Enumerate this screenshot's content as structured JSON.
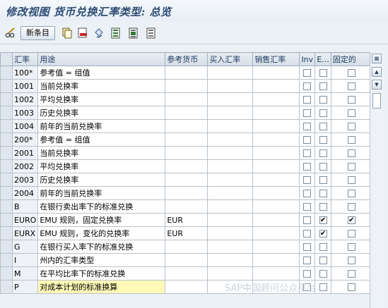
{
  "window": {
    "title": "修改视图 货币兑换汇率类型: 总览"
  },
  "toolbar": {
    "new_entries_label": "新条目",
    "icons": [
      "glasses-pen-icon",
      "copy-icon",
      "delete-icon",
      "undo-icon",
      "select-all-icon",
      "select-block-icon",
      "deselect-all-icon"
    ]
  },
  "table": {
    "columns": [
      "汇率",
      "用途",
      "参考货币",
      "买入汇率",
      "销售汇率",
      "Inv",
      "E...",
      "固定的"
    ],
    "rows": [
      {
        "key": "100*",
        "desc": "参考值 = 组值",
        "ref": "",
        "buy": "",
        "sell": "",
        "inv": false,
        "e": false,
        "fixed": false
      },
      {
        "key": "1001",
        "desc": "当前兑换率",
        "ref": "",
        "buy": "",
        "sell": "",
        "inv": false,
        "e": false,
        "fixed": false
      },
      {
        "key": "1002",
        "desc": "平均兑换率",
        "ref": "",
        "buy": "",
        "sell": "",
        "inv": false,
        "e": false,
        "fixed": false
      },
      {
        "key": "1003",
        "desc": "历史兑换率",
        "ref": "",
        "buy": "",
        "sell": "",
        "inv": false,
        "e": false,
        "fixed": false
      },
      {
        "key": "1004",
        "desc": "前年的当前兑换率",
        "ref": "",
        "buy": "",
        "sell": "",
        "inv": false,
        "e": false,
        "fixed": false
      },
      {
        "key": "200*",
        "desc": "参考值 = 组值",
        "ref": "",
        "buy": "",
        "sell": "",
        "inv": false,
        "e": false,
        "fixed": false
      },
      {
        "key": "2001",
        "desc": "当前兑换率",
        "ref": "",
        "buy": "",
        "sell": "",
        "inv": false,
        "e": false,
        "fixed": false
      },
      {
        "key": "2002",
        "desc": "平均兑换率",
        "ref": "",
        "buy": "",
        "sell": "",
        "inv": false,
        "e": false,
        "fixed": false
      },
      {
        "key": "2003",
        "desc": "历史兑换率",
        "ref": "",
        "buy": "",
        "sell": "",
        "inv": false,
        "e": false,
        "fixed": false
      },
      {
        "key": "2004",
        "desc": "前年的当前兑换率",
        "ref": "",
        "buy": "",
        "sell": "",
        "inv": false,
        "e": false,
        "fixed": false
      },
      {
        "key": "B",
        "desc": "在银行卖出率下的标准兑换",
        "ref": "",
        "buy": "",
        "sell": "",
        "inv": false,
        "e": false,
        "fixed": false
      },
      {
        "key": "EURO",
        "desc": "EMU 规则，固定兑换率",
        "ref": "EUR",
        "buy": "",
        "sell": "",
        "inv": false,
        "e": true,
        "fixed": true
      },
      {
        "key": "EURX",
        "desc": "EMU 规则，变化的兑换率",
        "ref": "EUR",
        "buy": "",
        "sell": "",
        "inv": false,
        "e": true,
        "fixed": false
      },
      {
        "key": "G",
        "desc": "在银行买入率下的标准兑换",
        "ref": "",
        "buy": "",
        "sell": "",
        "inv": false,
        "e": false,
        "fixed": false
      },
      {
        "key": "I",
        "desc": "州内的汇率类型",
        "ref": "",
        "buy": "",
        "sell": "",
        "inv": false,
        "e": false,
        "fixed": false
      },
      {
        "key": "M",
        "desc": "在平均比率下的标准兑换",
        "ref": "",
        "buy": "",
        "sell": "",
        "inv": false,
        "e": false,
        "fixed": false
      },
      {
        "key": "P",
        "desc": "对成本计划的标准换算",
        "ref": "",
        "buy": "",
        "sell": "",
        "inv": false,
        "e": false,
        "fixed": false
      }
    ]
  },
  "watermark": "SAP中国顾问公众平台",
  "colors": {
    "title": "#2d4b74",
    "header_text": "#1d3a5e",
    "highlight": "#fff9b8"
  }
}
